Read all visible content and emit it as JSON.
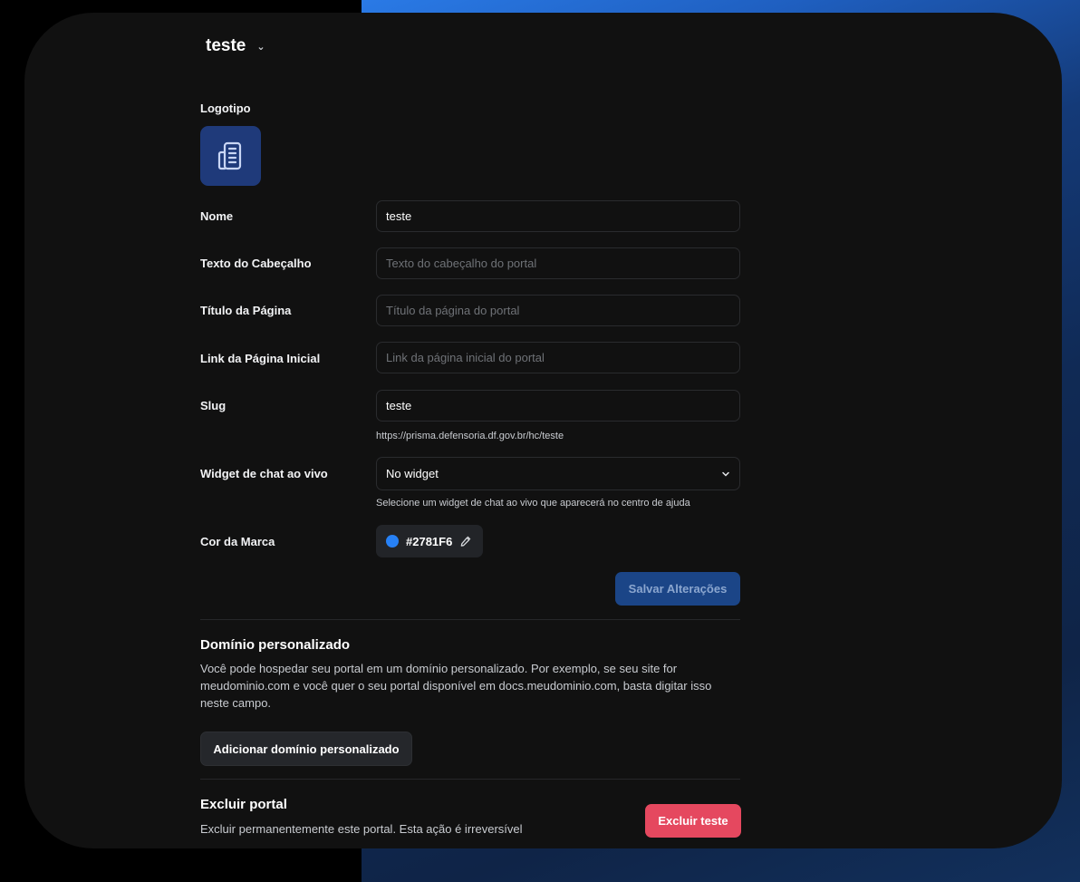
{
  "portal": {
    "name": "teste"
  },
  "form": {
    "logo_label": "Logotipo",
    "name_label": "Nome",
    "name_value": "teste",
    "header_text_label": "Texto do Cabeçalho",
    "header_text_placeholder": "Texto do cabeçalho do portal",
    "page_title_label": "Título da Página",
    "page_title_placeholder": "Título da página do portal",
    "home_link_label": "Link da Página Inicial",
    "home_link_placeholder": "Link da página inicial do portal",
    "slug_label": "Slug",
    "slug_value": "teste",
    "slug_url": "https://prisma.defensoria.df.gov.br/hc/teste",
    "widget_label": "Widget de chat ao vivo",
    "widget_value": "No widget",
    "widget_help": "Selecione um widget de chat ao vivo que aparecerá no centro de ajuda",
    "brand_color_label": "Cor da Marca",
    "brand_color_hex": "#2781F6",
    "save_label": "Salvar Alterações"
  },
  "custom_domain": {
    "title": "Domínio personalizado",
    "description": "Você pode hospedar seu portal em um domínio personalizado. Por exemplo, se seu site for meudominio.com e você quer o seu portal disponível em docs.meudominio.com, basta digitar isso neste campo.",
    "button_label": "Adicionar domínio personalizado"
  },
  "delete_portal": {
    "title": "Excluir portal",
    "description": "Excluir permanentemente este portal. Esta ação é irreversível",
    "button_label": "Excluir teste"
  },
  "icons": {
    "portal_chevron": "chevron-down-icon",
    "logo": "building-icon",
    "widget_chevron": "chevron-down-icon",
    "eyedropper": "eyedropper-icon"
  },
  "colors": {
    "brand": "#2781F6",
    "danger": "#E5485F",
    "save_button": "#1B4587",
    "logo_bg": "#1F3A7A"
  }
}
